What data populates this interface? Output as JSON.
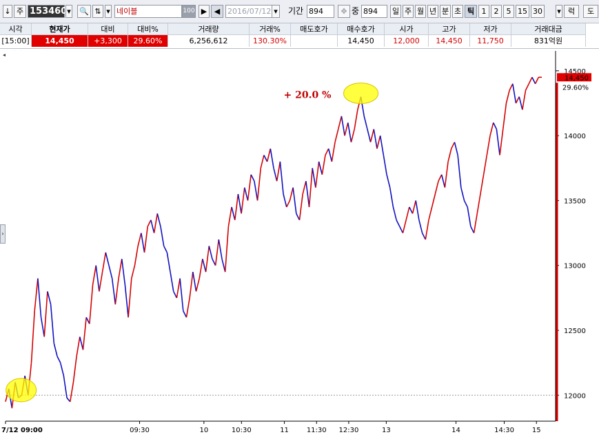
{
  "toolbar": {
    "arrow_label": "↓",
    "market_label": "주",
    "code": "153460",
    "search_glyph": "🔍",
    "list_glyph": "⇅",
    "name": "네이블",
    "zoom_value": "100",
    "date": "2016/07/12",
    "period_label": "기간",
    "period_value": "894",
    "ratio_label": "중",
    "ratio_value": "894",
    "timeframes": [
      "일",
      "주",
      "월",
      "년",
      "분",
      "초",
      "틱",
      "1",
      "2",
      "5",
      "15",
      "30"
    ],
    "selected_timeframe": "틱",
    "extra_label": "럭",
    "last_label": "도"
  },
  "quote": {
    "headers": [
      "시각",
      "현재가",
      "대비",
      "대비%",
      "거래량",
      "거래%",
      "매도호가",
      "매수호가",
      "시가",
      "고가",
      "저가",
      "거래대금"
    ],
    "values": [
      "[15:00]",
      "14,450",
      "+3,300",
      "29.60%",
      "6,256,612",
      "130.30%",
      "",
      "14,450",
      "12,000",
      "14,450",
      "11,750",
      "831억원"
    ]
  },
  "chart_label": "◀인차트(30틱-C)",
  "chart_data": {
    "type": "line",
    "title": "",
    "xlabel": "",
    "ylabel": "",
    "x_ticks": [
      "7/12 09:00",
      "09:30",
      "10",
      "10:30",
      "11",
      "11:30",
      "12:30",
      "13",
      "14",
      "14:30",
      "15"
    ],
    "y_ticks": [
      12000,
      12500,
      13000,
      13500,
      14000,
      14500
    ],
    "ylim": [
      11800,
      14600
    ],
    "reference_line": 12000,
    "last_price_label": "14,450",
    "last_change_label": "29.60%",
    "annotation": "+ 20.0 %",
    "series": [
      {
        "values": [
          11950,
          12050,
          11900,
          12100,
          11980,
          12000,
          12150,
          12000,
          12250,
          12650,
          12900,
          12600,
          12450,
          12800,
          12700,
          12400,
          12300,
          12250,
          12150,
          11980,
          11950,
          12100,
          12300,
          12450,
          12350,
          12600,
          12550,
          12850,
          13000,
          12800,
          12950,
          13100,
          13000,
          12900,
          12700,
          12900,
          13050,
          12850,
          12600,
          12900,
          13000,
          13150,
          13250,
          13100,
          13300,
          13350,
          13250,
          13400,
          13300,
          13150,
          13100,
          12950,
          12800,
          12750,
          12900,
          12650,
          12600,
          12750,
          12950,
          12800,
          12900,
          13050,
          12950,
          13150,
          13050,
          13000,
          13200,
          13050,
          12950,
          13300,
          13450,
          13350,
          13550,
          13400,
          13600,
          13500,
          13700,
          13650,
          13500,
          13750,
          13850,
          13800,
          13900,
          13750,
          13650,
          13800,
          13550,
          13450,
          13500,
          13600,
          13400,
          13350,
          13550,
          13650,
          13450,
          13750,
          13600,
          13800,
          13700,
          13850,
          13900,
          13800,
          13950,
          14050,
          14150,
          14000,
          14100,
          13950,
          14050,
          14200,
          14300,
          14150,
          14050,
          13950,
          14050,
          13900,
          14000,
          13850,
          13700,
          13600,
          13450,
          13350,
          13300,
          13250,
          13350,
          13450,
          13400,
          13500,
          13350,
          13250,
          13200,
          13350,
          13450,
          13550,
          13650,
          13700,
          13600,
          13800,
          13900,
          13950,
          13850,
          13600,
          13500,
          13450,
          13300,
          13250,
          13400,
          13550,
          13700,
          13850,
          14000,
          14100,
          14050,
          13850,
          14050,
          14250,
          14350,
          14400,
          14250,
          14300,
          14200,
          14350,
          14400,
          14450,
          14400,
          14450,
          14450
        ]
      }
    ]
  }
}
